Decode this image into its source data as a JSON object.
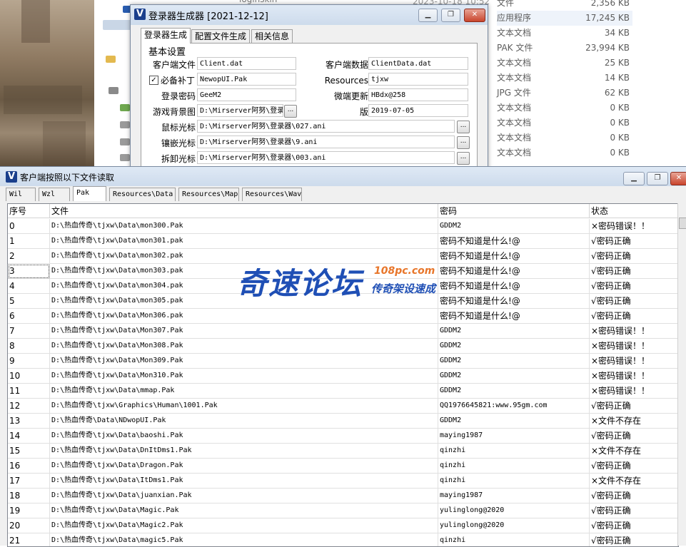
{
  "background_explorer": {
    "partial_top_text": "loginskin",
    "partial_date": "2023-10-18 10:52",
    "files": [
      {
        "type": "文件",
        "size": "2,356 KB"
      },
      {
        "type": "应用程序",
        "size": "17,245 KB"
      },
      {
        "type": "文本文档",
        "size": "34 KB"
      },
      {
        "type": "PAK 文件",
        "size": "23,994 KB"
      },
      {
        "type": "文本文档",
        "size": "25 KB"
      },
      {
        "type": "文本文档",
        "size": "14 KB"
      },
      {
        "type": "JPG 文件",
        "size": "62 KB"
      },
      {
        "type": "文本文档",
        "size": "0 KB"
      },
      {
        "type": "文本文档",
        "size": "0 KB"
      },
      {
        "type": "文本文档",
        "size": "0 KB"
      },
      {
        "type": "文本文档",
        "size": "0 KB"
      }
    ]
  },
  "generator": {
    "logo": "V",
    "title": "登录器生成器 [2021-12-12]",
    "tabs": [
      "登录器生成",
      "配置文件生成",
      "相关信息"
    ],
    "group": "基本设置",
    "client_file_label": "客户端文件",
    "client_file": "Client.dat",
    "client_data_label": "客户端数据文件",
    "client_data": "ClientData.dat",
    "patch_label": "必备补丁",
    "patch_checked": true,
    "patch": "NewopUI.Pak",
    "resources_label": "Resources目录",
    "resources": "tjxw",
    "password_label": "登录密码",
    "password": "GeeM2",
    "update_password_label": "微端更新密码",
    "update_password": "HBdx@258",
    "bg_label": "游戏背景图",
    "bg": "D:\\Mirserver阿努\\登录",
    "version_label": "版本号",
    "version": "2019-07-05",
    "cursor_label": "鼠标光标",
    "cursor": "D:\\Mirserver阿努\\登录器\\027.ani",
    "inlay_label": "镶嵌光标",
    "inlay": "D:\\Mirserver阿努\\登录器\\9.ani",
    "unload_label": "拆卸光标",
    "unload": "D:\\Mirserver阿努\\登录器\\003.ani",
    "browse": "..."
  },
  "reader": {
    "logo": "V",
    "title": "客户端按照以下文件读取",
    "tabs": [
      "Wil",
      "Wzl",
      "Pak",
      "Resources\\Data",
      "Resources\\Map",
      "Resources\\Wav"
    ],
    "active_tab": 2,
    "columns": [
      "序号",
      "文件",
      "密码",
      "状态"
    ],
    "rows": [
      {
        "no": "0",
        "file": "D:\\热血传奇\\tjxw\\Data\\mon300.Pak",
        "pw": "GDDM2",
        "status": "×密码错误！！"
      },
      {
        "no": "1",
        "file": "D:\\热血传奇\\tjxw\\Data\\mon301.pak",
        "pw": "密码不知道是什么!@",
        "status": "√密码正确"
      },
      {
        "no": "2",
        "file": "D:\\热血传奇\\tjxw\\Data\\mon302.pak",
        "pw": "密码不知道是什么!@",
        "status": "√密码正确"
      },
      {
        "no": "3",
        "file": "D:\\热血传奇\\tjxw\\Data\\mon303.pak",
        "pw": "密码不知道是什么!@",
        "status": "√密码正确"
      },
      {
        "no": "4",
        "file": "D:\\热血传奇\\tjxw\\Data\\mon304.pak",
        "pw": "密码不知道是什么!@",
        "status": "√密码正确"
      },
      {
        "no": "5",
        "file": "D:\\热血传奇\\tjxw\\Data\\mon305.pak",
        "pw": "密码不知道是什么!@",
        "status": "√密码正确"
      },
      {
        "no": "6",
        "file": "D:\\热血传奇\\tjxw\\Data\\Mon306.pak",
        "pw": "密码不知道是什么!@",
        "status": "√密码正确"
      },
      {
        "no": "7",
        "file": "D:\\热血传奇\\tjxw\\Data\\Mon307.Pak",
        "pw": "GDDM2",
        "status": "×密码错误！！"
      },
      {
        "no": "8",
        "file": "D:\\热血传奇\\tjxw\\Data\\Mon308.Pak",
        "pw": "GDDM2",
        "status": "×密码错误！！"
      },
      {
        "no": "9",
        "file": "D:\\热血传奇\\tjxw\\Data\\Mon309.Pak",
        "pw": "GDDM2",
        "status": "×密码错误！！"
      },
      {
        "no": "10",
        "file": "D:\\热血传奇\\tjxw\\Data\\Mon310.Pak",
        "pw": "GDDM2",
        "status": "×密码错误！！"
      },
      {
        "no": "11",
        "file": "D:\\热血传奇\\tjxw\\Data\\mmap.Pak",
        "pw": "GDDM2",
        "status": "×密码错误！！"
      },
      {
        "no": "12",
        "file": "D:\\热血传奇\\tjxw\\Graphics\\Human\\1001.Pak",
        "pw": "QQ1976645821:www.95gm.com",
        "status": "√密码正确"
      },
      {
        "no": "13",
        "file": "D:\\热血传奇\\Data\\NDwopUI.Pak",
        "pw": "GDDM2",
        "status": "×文件不存在"
      },
      {
        "no": "14",
        "file": "D:\\热血传奇\\tjxw\\Data\\baoshi.Pak",
        "pw": "maying1987",
        "status": "√密码正确"
      },
      {
        "no": "15",
        "file": "D:\\热血传奇\\tjxw\\Data\\DnItDms1.Pak",
        "pw": "qinzhi",
        "status": "×文件不存在"
      },
      {
        "no": "16",
        "file": "D:\\热血传奇\\tjxw\\Data\\Dragon.Pak",
        "pw": "qinzhi",
        "status": "√密码正确"
      },
      {
        "no": "17",
        "file": "D:\\热血传奇\\tjxw\\Data\\ItDms1.Pak",
        "pw": "qinzhi",
        "status": "×文件不存在"
      },
      {
        "no": "18",
        "file": "D:\\热血传奇\\tjxw\\Data\\juanxian.Pak",
        "pw": "maying1987",
        "status": "√密码正确"
      },
      {
        "no": "19",
        "file": "D:\\热血传奇\\tjxw\\Data\\Magic.Pak",
        "pw": "yulinglong@2020",
        "status": "√密码正确"
      },
      {
        "no": "20",
        "file": "D:\\热血传奇\\tjxw\\Data\\Magic2.Pak",
        "pw": "yulinglong@2020",
        "status": "√密码正确"
      },
      {
        "no": "21",
        "file": "D:\\热血传奇\\tjxw\\Data\\magic5.Pak",
        "pw": "qinzhi",
        "status": "√密码正确"
      }
    ]
  },
  "watermark": {
    "main": "奇速论坛",
    "domain": "108pc.com",
    "sub": "传奇架设速成"
  }
}
